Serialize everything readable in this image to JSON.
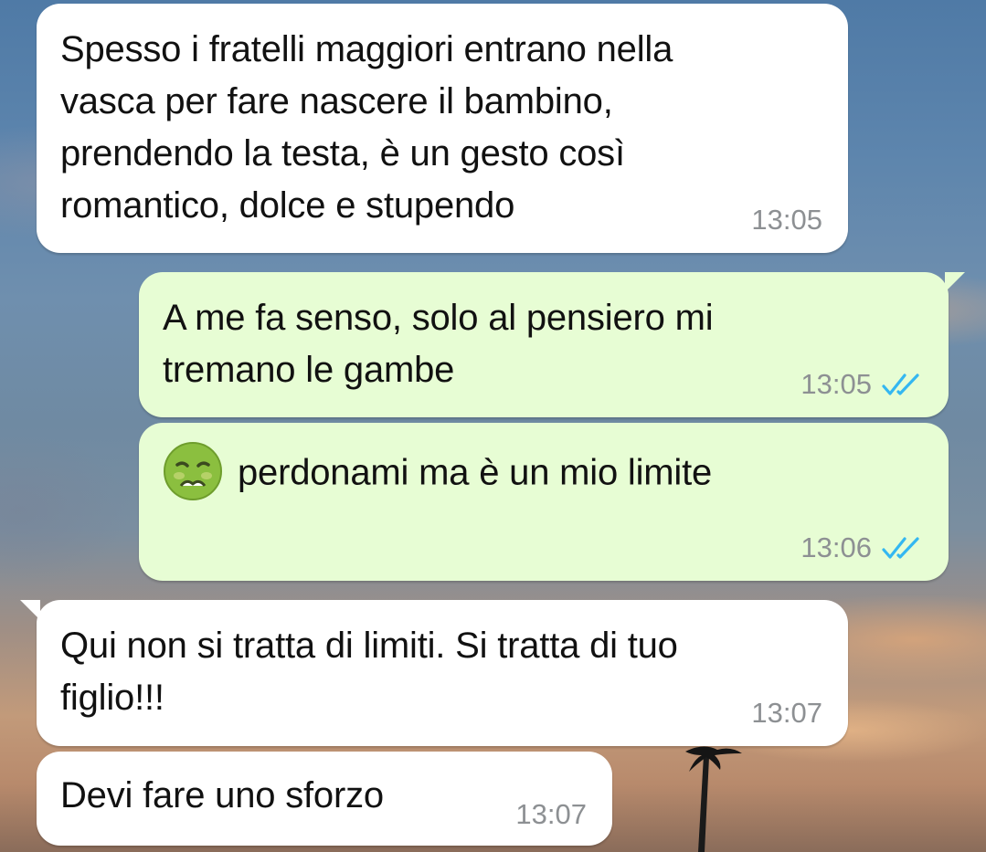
{
  "chat": {
    "messages": [
      {
        "direction": "incoming",
        "text": "Spesso i fratelli maggiori entrano nella\nvasca per fare nascere il bambino,\nprendendo la testa, è un gesto così\nromantico, dolce e stupendo",
        "time": "13:05"
      },
      {
        "direction": "outgoing",
        "text": "A me fa senso, solo al pensiero mi\ntremano le gambe",
        "time": "13:05",
        "status_icon": "double-check-read-icon"
      },
      {
        "direction": "outgoing",
        "emoji": "nauseated-face-emoji",
        "text": "perdonami ma è un mio limite",
        "time": "13:06",
        "status_icon": "double-check-read-icon"
      },
      {
        "direction": "incoming",
        "text": "Qui non si tratta di limiti. Si tratta di tuo\nfiglio!!!",
        "time": "13:07"
      },
      {
        "direction": "incoming",
        "text": "Devi fare uno sforzo",
        "time": "13:07"
      }
    ]
  },
  "colors": {
    "incoming_bubble": "#ffffff",
    "outgoing_bubble": "#e7fdd4",
    "timestamp": "#8d9093",
    "read_ticks": "#34b7f1"
  }
}
